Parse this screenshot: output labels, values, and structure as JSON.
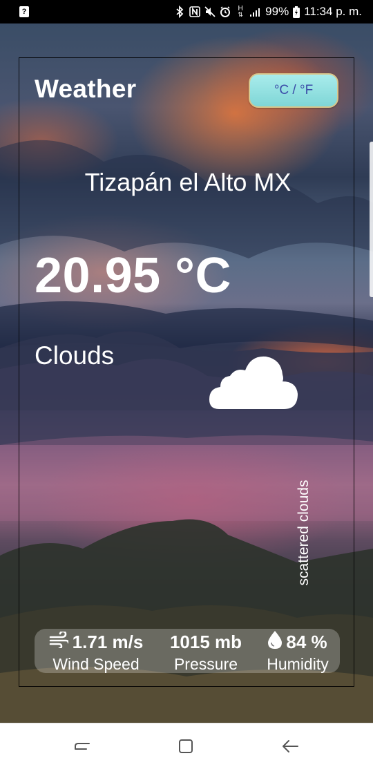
{
  "status_bar": {
    "battery": "99%",
    "time": "11:34 p. m.",
    "icons": [
      "notification-icon",
      "bluetooth-icon",
      "nfc-icon",
      "mute-icon",
      "alarm-icon",
      "hplus-icon",
      "signal-icon",
      "battery-icon"
    ],
    "network": "H"
  },
  "header": {
    "title": "Weather",
    "unit_toggle": "°C / °F"
  },
  "weather": {
    "location": "Tizapán el Alto MX",
    "temperature": "20.95 °C",
    "condition": "Clouds",
    "condition_icon": "cloud-icon",
    "description": "scattered clouds"
  },
  "stats": {
    "wind_value": "1.71 m/s",
    "wind_label": "Wind Speed",
    "pressure_value": "1015 mb",
    "pressure_label": "Pressure",
    "humidity_value": "84 %",
    "humidity_label": "Humidity"
  },
  "nav": {
    "items": [
      "recent-apps-icon",
      "home-icon",
      "back-icon"
    ]
  },
  "colors": {
    "toggle_bg": "#a9ecec",
    "toggle_text": "#3b4ba8",
    "text": "#ffffff"
  }
}
